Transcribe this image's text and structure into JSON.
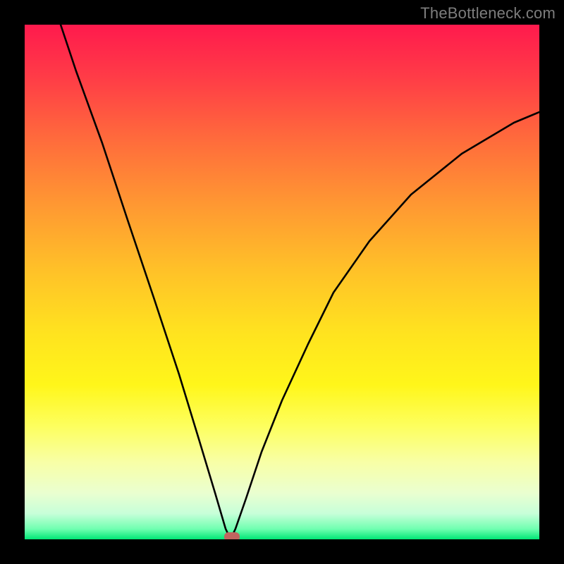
{
  "watermark": "TheBottleneck.com",
  "chart_data": {
    "type": "line",
    "title": "",
    "xlabel": "",
    "ylabel": "",
    "xlim": [
      0,
      100
    ],
    "ylim": [
      0,
      100
    ],
    "background": "gradient green-yellow-red (bottom→top)",
    "grid": false,
    "legend": false,
    "series": [
      {
        "name": "bottleneck-curve",
        "description": "V-shaped curve; minimum near x≈40, y≈0",
        "x": [
          7,
          10,
          15,
          20,
          25,
          30,
          34,
          37,
          39,
          40,
          41,
          43,
          46,
          50,
          55,
          60,
          67,
          75,
          85,
          95,
          100
        ],
        "y": [
          100,
          91,
          77,
          62,
          47,
          32,
          19,
          9,
          2,
          0,
          2,
          8,
          17,
          27,
          38,
          48,
          58,
          67,
          75,
          81,
          83
        ]
      }
    ],
    "marker": {
      "x": 40,
      "y": 0,
      "shape": "rounded-rect",
      "color": "#c1655f"
    }
  },
  "colors": {
    "frame": "#000000",
    "curve": "#000000",
    "watermark": "#7d7d7d",
    "marker": "#c1655f"
  }
}
